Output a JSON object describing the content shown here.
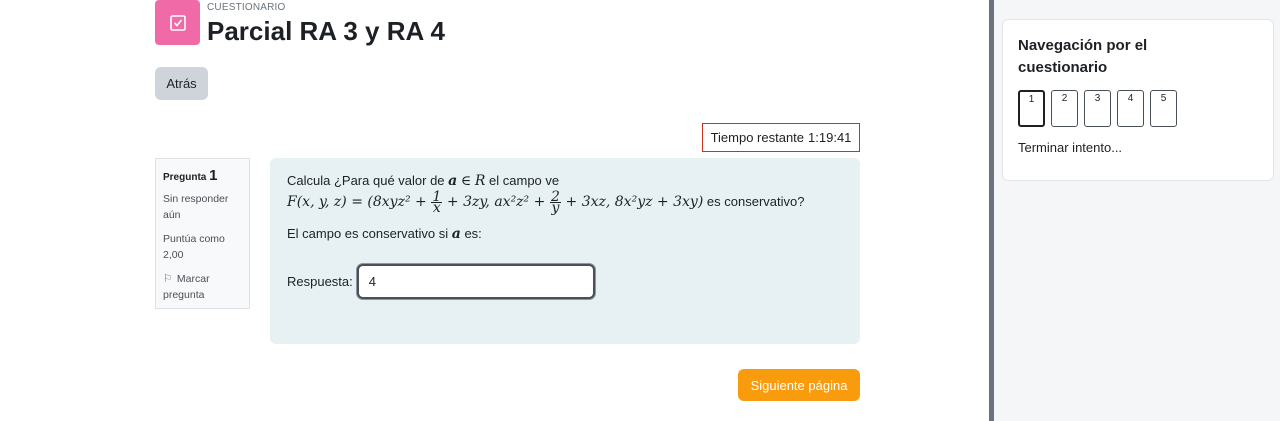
{
  "header": {
    "activity_type": "CUESTIONARIO",
    "title": "Parcial RA 3 y RA 4",
    "icon": "quiz-icon",
    "icon_color": "#f06aa8"
  },
  "back_button": "Atrás",
  "timer": {
    "label": "Tiempo restante",
    "value": "1:19:41"
  },
  "question_info": {
    "label": "Pregunta",
    "number": "1",
    "state": "Sin responder aún",
    "grade": "Puntúa como 2,00",
    "flag": "Marcar pregunta"
  },
  "question": {
    "text_start": "Calcula ¿Para qué valor de",
    "var_a": "a",
    "in_symbol": "∈",
    "set_R": "R",
    "text_end": "el campo ve",
    "formula_a": "F(x, y, z) = (8xyz² +",
    "frac1_num": "1",
    "frac1_den": "x",
    "formula_b": "+ 3zy, ax²z² +",
    "frac2_num": "2",
    "frac2_den": "y",
    "formula_c": "+ 3xz, 8x²yz + 3xy)",
    "formula_suffix": "es conservativo?",
    "prompt_start": "El campo es conservativo si",
    "prompt_var": "a",
    "prompt_end": "es:",
    "answer_label": "Respuesta:",
    "answer_value": "4"
  },
  "next_button": "Siguiente página",
  "next_button_color": "#f89c0e",
  "navigation": {
    "title": "Navegación por el cuestionario",
    "buttons": [
      "1",
      "2",
      "3",
      "4",
      "5"
    ],
    "current": "1",
    "finish_link": "Terminar intento..."
  }
}
